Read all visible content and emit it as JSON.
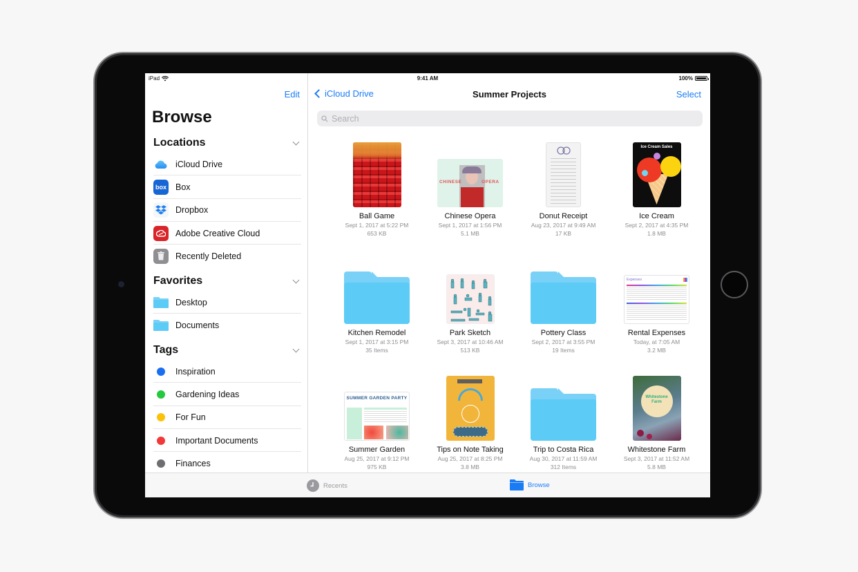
{
  "status_bar": {
    "device": "iPad",
    "time": "9:41 AM",
    "battery": "100%",
    "battery_level": 1.0
  },
  "sidebar": {
    "edit_label": "Edit",
    "title": "Browse",
    "sections": [
      {
        "title": "Locations",
        "items": [
          {
            "label": "iCloud Drive",
            "icon": "icloud-icon"
          },
          {
            "label": "Box",
            "icon": "box-icon",
            "icon_text": "box"
          },
          {
            "label": "Dropbox",
            "icon": "dropbox-icon"
          },
          {
            "label": "Adobe Creative Cloud",
            "icon": "adobe-creative-cloud-icon"
          },
          {
            "label": "Recently Deleted",
            "icon": "trash-icon"
          }
        ]
      },
      {
        "title": "Favorites",
        "items": [
          {
            "label": "Desktop",
            "icon": "folder-icon"
          },
          {
            "label": "Documents",
            "icon": "folder-icon"
          }
        ]
      },
      {
        "title": "Tags",
        "items": [
          {
            "label": "Inspiration",
            "color": "#1a6ff0"
          },
          {
            "label": "Gardening Ideas",
            "color": "#25c93f"
          },
          {
            "label": "For Fun",
            "color": "#fcc10b"
          },
          {
            "label": "Important Documents",
            "color": "#f23838"
          },
          {
            "label": "Finances",
            "color": "#6d6d72"
          }
        ]
      }
    ]
  },
  "main": {
    "back_label": "iCloud Drive",
    "title": "Summer Projects",
    "select_label": "Select",
    "search_placeholder": "Search",
    "items": [
      {
        "name": "Ball Game",
        "date": "Sept 1, 2017 at 5:22 PM",
        "size": "653 KB",
        "kind": "photo"
      },
      {
        "name": "Chinese Opera",
        "date": "Sept 1, 2017 at 1:56 PM",
        "size": "5.1 MB",
        "kind": "document",
        "thumb_text": [
          "CHINESE",
          "OPERA"
        ]
      },
      {
        "name": "Donut Receipt",
        "date": "Aug 23, 2017 at 9:49 AM",
        "size": "17 KB",
        "kind": "receipt"
      },
      {
        "name": "Ice Cream",
        "date": "Sept 2, 2017 at 4:35 PM",
        "size": "1.8 MB",
        "kind": "poster",
        "thumb_text": "Ice Cream Sales"
      },
      {
        "name": "Kitchen Remodel",
        "date": "Sept 1, 2017 at 3:15 PM",
        "size": "35 Items",
        "kind": "folder"
      },
      {
        "name": "Park Sketch",
        "date": "Sept 3, 2017 at 10:46 AM",
        "size": "513 KB",
        "kind": "sketch"
      },
      {
        "name": "Pottery Class",
        "date": "Sept 2, 2017 at 3:55 PM",
        "size": "19 Items",
        "kind": "folder"
      },
      {
        "name": "Rental Expenses",
        "date": "Today, at 7:05 AM",
        "size": "3.2 MB",
        "kind": "spreadsheet",
        "thumb_text": "Expenses"
      },
      {
        "name": "Summer Garden",
        "date": "Aug 25, 2017 at 9:12 PM",
        "size": "975 KB",
        "kind": "spreadsheet-garden",
        "thumb_text": "SUMMER GARDEN PARTY"
      },
      {
        "name": "Tips on Note Taking",
        "date": "Aug 25, 2017 at 8:25 PM",
        "size": "3.8 MB",
        "kind": "notes"
      },
      {
        "name": "Trip to Costa Rica",
        "date": "Aug 30, 2017 at 11:59 AM",
        "size": "312 Items",
        "kind": "folder"
      },
      {
        "name": "Whitestone Farm",
        "date": "Sept 3, 2017 at 11:52 AM",
        "size": "5.8 MB",
        "kind": "farm",
        "thumb_text": [
          "Whitestone",
          "Farm"
        ]
      }
    ]
  },
  "tab_bar": {
    "tabs": [
      {
        "label": "Recents",
        "icon": "clock-icon",
        "active": false
      },
      {
        "label": "Browse",
        "icon": "folder-icon",
        "active": true
      }
    ]
  },
  "colors": {
    "accent": "#1a7cf5",
    "folder": "#5ccbf6"
  }
}
